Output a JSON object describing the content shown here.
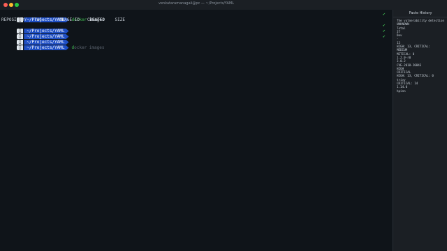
{
  "window": {
    "title": "venkataramanagali@pc — ~/Projects/YAML"
  },
  "colors": {
    "prompt_dir_bg": "#1f4fc4",
    "command": "#3fb950",
    "check": "#3fb950"
  },
  "terminal": {
    "prompt_dir": "~/Projects/YAML",
    "line1": {
      "cmd": "docker",
      "arg": "images"
    },
    "header": "REPOSITORY   TAG       IMAGE ID   CREATED    SIZE",
    "ghost": {
      "first": "d",
      "rest": "ocker images"
    },
    "check_icon": "check-icon"
  },
  "paste_history": {
    "title": "Paste History",
    "items": [
      "The vulnerability detection,",
      "UNKNOWN",
      "Total",
      "37",
      "Dev",
      "-",
      "13",
      "HIGH: 13, CRITICAL:",
      "MEDIUM",
      "MITICAL: 0",
      "1.2.0-r0",
      "3.0.2",
      "CVE-2018-20843",
      "HIGH",
      "CRITICAL",
      "HIGH: 13, CRITICAL: 0",
      "trivy",
      "CRITICAL: 14",
      "1.14.0",
      "hpinn"
    ]
  }
}
